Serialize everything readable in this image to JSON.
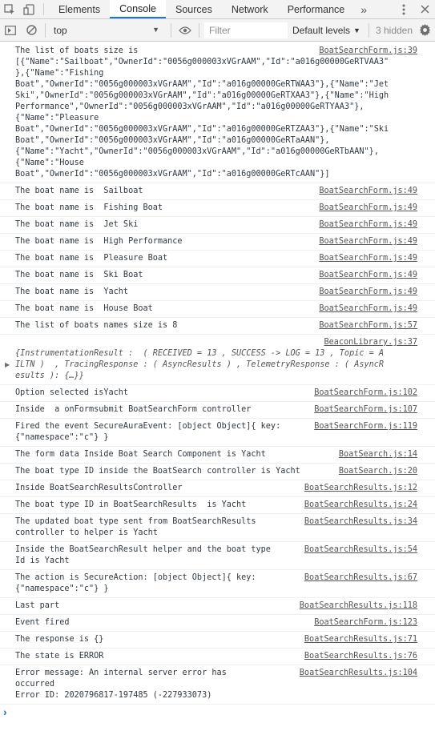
{
  "tabs": [
    {
      "label": "Elements"
    },
    {
      "label": "Console"
    },
    {
      "label": "Sources"
    },
    {
      "label": "Network"
    },
    {
      "label": "Performance"
    }
  ],
  "more_tabs": "»",
  "toolbar": {
    "context": "top",
    "filter_placeholder": "Filter",
    "levels": "Default levels",
    "hidden": "3 hidden"
  },
  "messages": [
    {
      "text": "The list of boats size is\n[{\"Name\":\"Sailboat\",\"OwnerId\":\"0056g000003xVGrAAM\",\"Id\":\"a016g00000GeRTVAA3\"\n},{\"Name\":\"Fishing\nBoat\",\"OwnerId\":\"0056g000003xVGrAAM\",\"Id\":\"a016g00000GeRTWAA3\"},{\"Name\":\"Jet\nSki\",\"OwnerId\":\"0056g000003xVGrAAM\",\"Id\":\"a016g00000GeRTXAA3\"},{\"Name\":\"High\nPerformance\",\"OwnerId\":\"0056g000003xVGrAAM\",\"Id\":\"a016g00000GeRTYAA3\"},\n{\"Name\":\"Pleasure\nBoat\",\"OwnerId\":\"0056g000003xVGrAAM\",\"Id\":\"a016g00000GeRTZAA3\"},{\"Name\":\"Ski\nBoat\",\"OwnerId\":\"0056g000003xVGrAAM\",\"Id\":\"a016g00000GeRTaAAN\"},\n{\"Name\":\"Yacht\",\"OwnerId\":\"0056g000003xVGrAAM\",\"Id\":\"a016g00000GeRTbAAN\"},\n{\"Name\":\"House\nBoat\",\"OwnerId\":\"0056g000003xVGrAAM\",\"Id\":\"a016g00000GeRTcAAN\"}]",
      "source": "BoatSearchForm.js:39"
    },
    {
      "text": "The boat name is  Sailboat",
      "source": "BoatSearchForm.js:49"
    },
    {
      "text": "The boat name is  Fishing Boat",
      "source": "BoatSearchForm.js:49"
    },
    {
      "text": "The boat name is  Jet Ski",
      "source": "BoatSearchForm.js:49"
    },
    {
      "text": "The boat name is  High Performance",
      "source": "BoatSearchForm.js:49"
    },
    {
      "text": "The boat name is  Pleasure Boat",
      "source": "BoatSearchForm.js:49"
    },
    {
      "text": "The boat name is  Ski Boat",
      "source": "BoatSearchForm.js:49"
    },
    {
      "text": "The boat name is  Yacht",
      "source": "BoatSearchForm.js:49"
    },
    {
      "text": "The boat name is  House Boat",
      "source": "BoatSearchForm.js:49"
    },
    {
      "text": "The list of boats names size is 8",
      "source": "BoatSearchForm.js:57"
    },
    {
      "text": "{InstrumentationResult :  ( RECEIVED = 13 , SUCCESS -> LOG = 13 , Topic = A\nILTN )  , TracingResponse : ( AsyncResults ) , TelemetryResponse : ( AsyncR\nesults ): {…}}",
      "source": "BeaconLibrary.js:37",
      "object": true
    },
    {
      "text": "Option selected isYacht",
      "source": "BoatSearchForm.js:102"
    },
    {
      "text": "Inside  a onFormsubmit BoatSearchForm controller",
      "source": "BoatSearchForm.js:107"
    },
    {
      "text": "Fired the event SecureAuraEvent: [object Object]{ key:\n{\"namespace\":\"c\"} }",
      "source": "BoatSearchForm.js:119"
    },
    {
      "text": "The form data Inside Boat Search Component is Yacht",
      "source": "BoatSearch.js:14"
    },
    {
      "text": "The boat type ID inside the BoatSearch controller is Yacht",
      "source": "BoatSearch.js:20"
    },
    {
      "text": "Inside BoatSearchResultsController",
      "source": "BoatSearchResults.js:12"
    },
    {
      "text": "The boat type ID in BoatSearchResults  is Yacht",
      "source": "BoatSearchResults.js:24"
    },
    {
      "text": "The updated boat type sent from BoatSearchResults\ncontroller to helper is Yacht",
      "source": "BoatSearchResults.js:34"
    },
    {
      "text": "Inside the BoatSearchResult helper and the boat type\nId is Yacht",
      "source": "BoatSearchResults.js:54"
    },
    {
      "text": "The action is SecureAction: [object Object]{ key:\n{\"namespace\":\"c\"} }",
      "source": "BoatSearchResults.js:67"
    },
    {
      "text": "Last part",
      "source": "BoatSearchResults.js:118"
    },
    {
      "text": "Event fired",
      "source": "BoatSearchForm.js:123"
    },
    {
      "text": "The response is {}",
      "source": "BoatSearchResults.js:71"
    },
    {
      "text": "The state is ERROR",
      "source": "BoatSearchResults.js:76"
    },
    {
      "text": "Error message: An internal server error has\noccurred\nError ID: 2020796817-197485 (-227933073)",
      "source": "BoatSearchResults.js:104"
    }
  ],
  "prompt_symbol": "›"
}
